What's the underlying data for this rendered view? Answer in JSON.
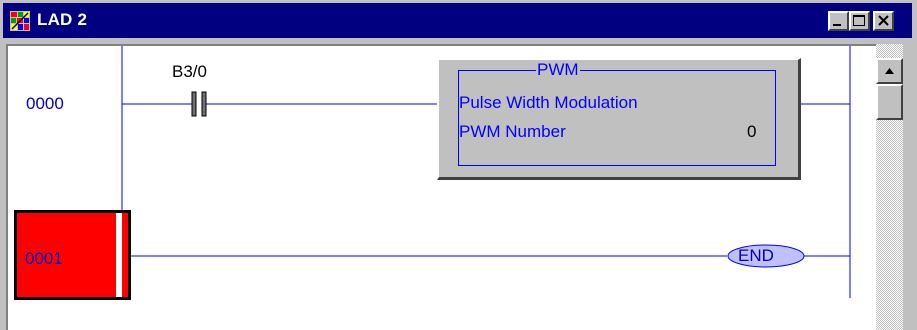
{
  "window": {
    "title": "LAD 2",
    "icon": "ladder-app-icon",
    "controls": [
      "minimize-icon",
      "maximize-icon",
      "close-icon"
    ]
  },
  "colors": {
    "titlebar": "#000080",
    "wire": "#0000ff",
    "rung_number": "#0000c0",
    "selected_rung": "#ff0000",
    "instruction_box": "#c0c0c0"
  },
  "rungs": [
    {
      "number": "0000"
    },
    {
      "number": "0001",
      "selected": true
    }
  ],
  "contact": {
    "address": "B3/0",
    "type": "XIC"
  },
  "pwm": {
    "title": "PWM",
    "description": "Pulse Width Modulation",
    "param_label": "PWM Number",
    "param_value": "0"
  },
  "end_marker": "END"
}
